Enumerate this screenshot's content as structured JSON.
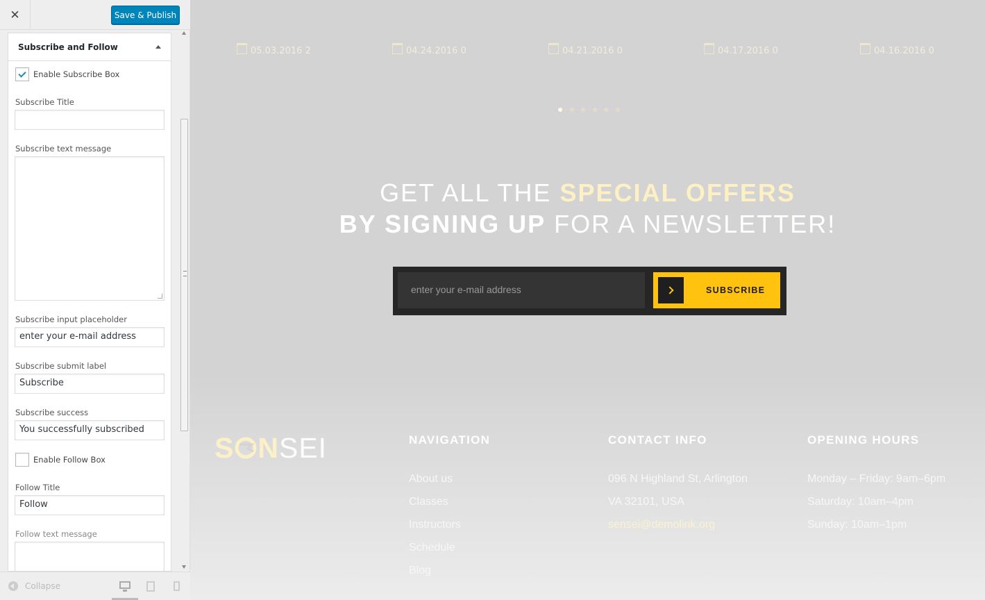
{
  "topbar": {
    "close_symbol": "✕",
    "save_label": "Save & Publish"
  },
  "section": {
    "title": "Subscribe and Follow"
  },
  "fields": {
    "enable_subscribe": "Enable Subscribe Box",
    "subscribe_title_label": "Subscribe Title",
    "subscribe_title_value": "",
    "subscribe_text_label": "Subscribe text message",
    "subscribe_placeholder_label": "Subscribe input placeholder",
    "subscribe_placeholder_value": "enter your e-mail address",
    "subscribe_submit_label": "Subscribe submit label",
    "subscribe_submit_value": "Subscribe",
    "subscribe_success_label": "Subscribe success",
    "subscribe_success_value": "You successfully subscribed",
    "enable_follow": "Enable Follow Box",
    "follow_title_label": "Follow Title",
    "follow_title_value": "Follow",
    "follow_text_label": "Follow text message"
  },
  "footer_bar": {
    "collapse": "Collapse"
  },
  "preview": {
    "dates": [
      "05.03.2016 2",
      "04.24.2016 0",
      "04.21.2016 0",
      "04.17.2016 0",
      "04.16.2016 0"
    ],
    "hero": {
      "line1_a": "GET ALL THE ",
      "line1_b": "SPECIAL OFFERS",
      "line2_a": "BY SIGNING UP",
      "line2_b": " FOR A NEWSLETTER!"
    },
    "subscribe": {
      "placeholder": "enter your e-mail address",
      "button": "SUBSCRIBE"
    },
    "logo": {
      "part1": "S",
      "part2": "N",
      "part3": "SEI"
    },
    "navigation": {
      "title": "NAVIGATION",
      "items": [
        "About us",
        "Classes",
        "Instructors",
        "Schedule",
        "Blog"
      ]
    },
    "contact": {
      "title": "CONTACT INFO",
      "address1": "096 N Highland St, Arlington",
      "address2": "VA 32101, USA",
      "email": "sensei@demolink.org"
    },
    "hours": {
      "title": "OPENING HOURS",
      "items": [
        "Monday – Friday: 9am–6pm",
        "Saturday: 10am–4pm",
        "Sunday: 10am–1pm"
      ]
    }
  }
}
